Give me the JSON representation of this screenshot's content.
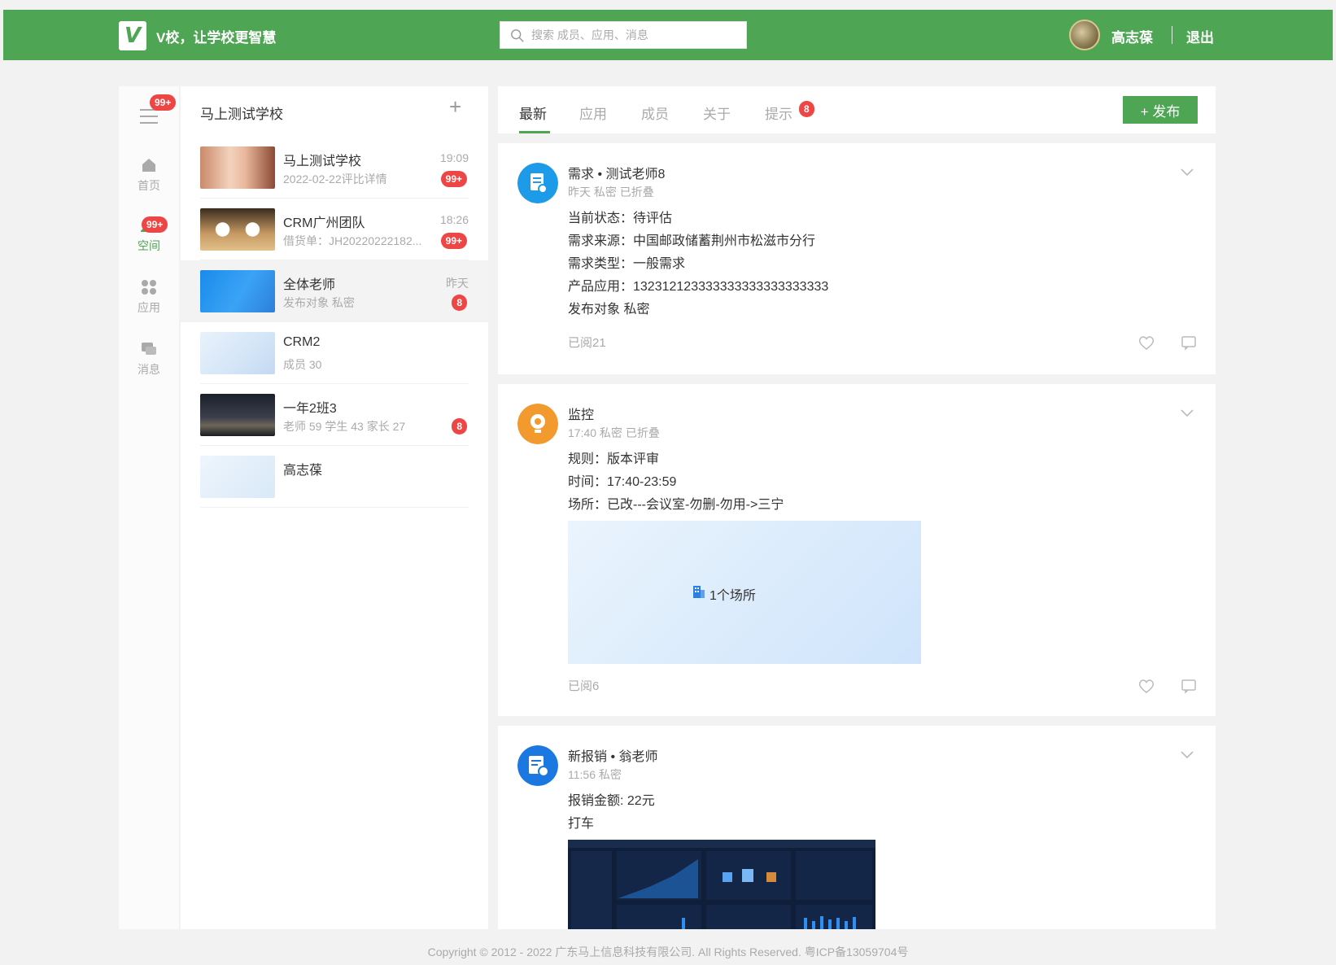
{
  "header": {
    "logo_letter": "V",
    "brand": "V校，让学校更智慧",
    "search_placeholder": "搜索 成员、应用、消息",
    "user_name": "高志葆",
    "logout": "退出",
    "color": "#4ea553"
  },
  "nav": {
    "menu_badge": "99+",
    "items": [
      {
        "label": "首页",
        "icon": "home-icon",
        "badge": ""
      },
      {
        "label": "空间",
        "icon": "people-icon",
        "badge": "99+"
      },
      {
        "label": "应用",
        "icon": "apps-icon",
        "badge": ""
      },
      {
        "label": "消息",
        "icon": "message-icon",
        "badge": ""
      }
    ]
  },
  "list": {
    "title": "马上测试学校",
    "add": "+",
    "items": [
      {
        "name": "马上测试学校",
        "sub": "2022-02-22评比详情",
        "time": "19:09",
        "badge": "99+"
      },
      {
        "name": "CRM广州团队",
        "sub": "借货单：JH20220222182...",
        "time": "18:26",
        "badge": "99+"
      },
      {
        "name": "全体老师",
        "sub": "发布对象 私密",
        "time": "昨天",
        "badge": "8"
      },
      {
        "name": "CRM2",
        "sub": "成员 30",
        "time": "",
        "badge": ""
      },
      {
        "name": "一年2班3",
        "sub": "老师 59 学生 43 家长 27",
        "time": "",
        "badge": "8"
      },
      {
        "name": "高志葆",
        "sub": "",
        "time": "",
        "badge": ""
      }
    ]
  },
  "feed": {
    "tabs": [
      "最新",
      "应用",
      "成员",
      "关于",
      "提示"
    ],
    "tip_badge": "8",
    "publish": "+ 发布",
    "posts": [
      {
        "title": "需求 • 测试老师8",
        "meta": "昨天 私密  已折叠",
        "lines": [
          "当前状态：待评估",
          "需求来源：中国邮政储蓄荆州市松滋市分行",
          "需求类型：一般需求",
          "产品应用：132312123333333333333333333",
          "发布对象 私密"
        ],
        "read": "已阅21"
      },
      {
        "title": "监控",
        "meta": "17:40 私密  已折叠",
        "lines": [
          "规则：版本评审",
          "时间：17:40-23:59",
          "场所：已改---会议室-勿删-勿用->三宁"
        ],
        "venue": "1个场所",
        "read": "已阅6"
      },
      {
        "title": "新报销 • 翁老师",
        "meta": "11:56 私密",
        "lines": [
          "报销金额: 22元",
          "打车"
        ],
        "read": ""
      }
    ]
  },
  "footer": "Copyright © 2012 - 2022 广东马上信息科技有限公司. All Rights Reserved. 粤ICP备13059704号"
}
